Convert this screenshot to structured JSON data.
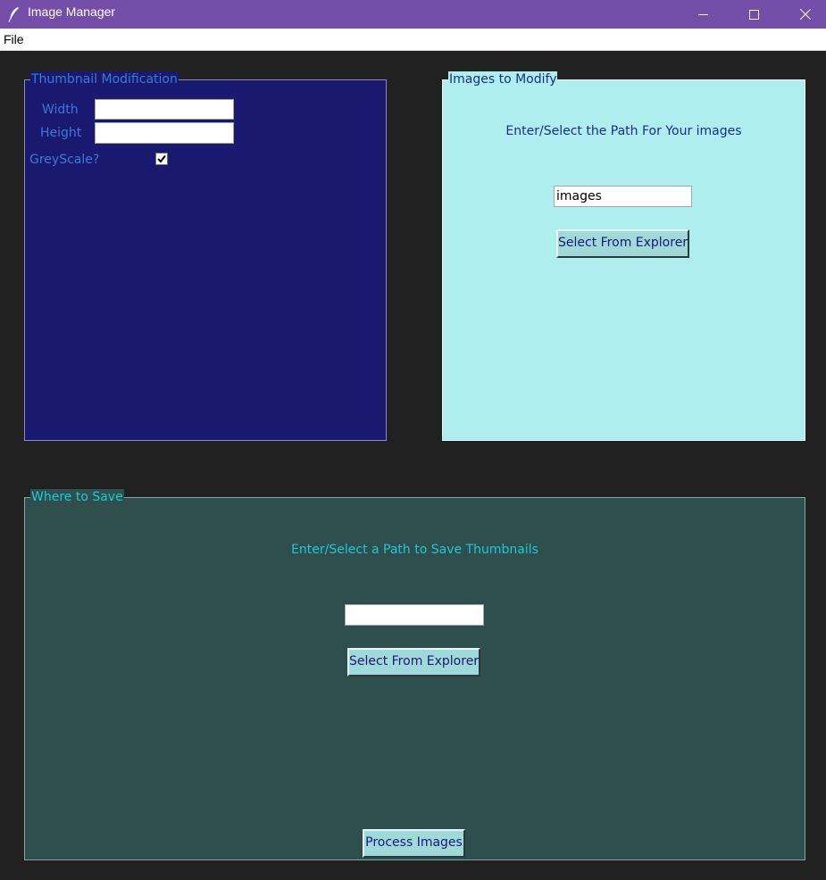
{
  "window": {
    "title": "Image Manager",
    "controls": [
      "minimize",
      "maximize",
      "close"
    ]
  },
  "menu": {
    "file_label": "File"
  },
  "thumbnail_frame": {
    "label": "Thumbnail Modification",
    "width_label": "Width",
    "width_value": "",
    "height_label": "Height",
    "height_value": "",
    "greyscale_label": "GreyScale?",
    "greyscale_checked": true
  },
  "images_frame": {
    "label": "Images to Modify",
    "instruction": "Enter/Select the Path For Your images",
    "path_value": "images",
    "select_button": "Select From Explorer"
  },
  "save_frame": {
    "label": "Where to Save",
    "instruction": "Enter/Select a Path to Save Thumbnails",
    "path_value": "",
    "select_button": "Select From Explorer",
    "process_button": "Process Images"
  },
  "colors": {
    "titlebar": "#744da9",
    "background": "#212121",
    "thumbnail_bg": "#191970",
    "images_bg": "#afeeee",
    "save_bg": "#2f4f4f",
    "button_bg": "#9fd9da"
  },
  "icons": {
    "app": "feather-icon",
    "minimize": "minimize-icon",
    "maximize": "maximize-icon",
    "close": "close-icon",
    "checkbox": "checkmark-icon"
  }
}
